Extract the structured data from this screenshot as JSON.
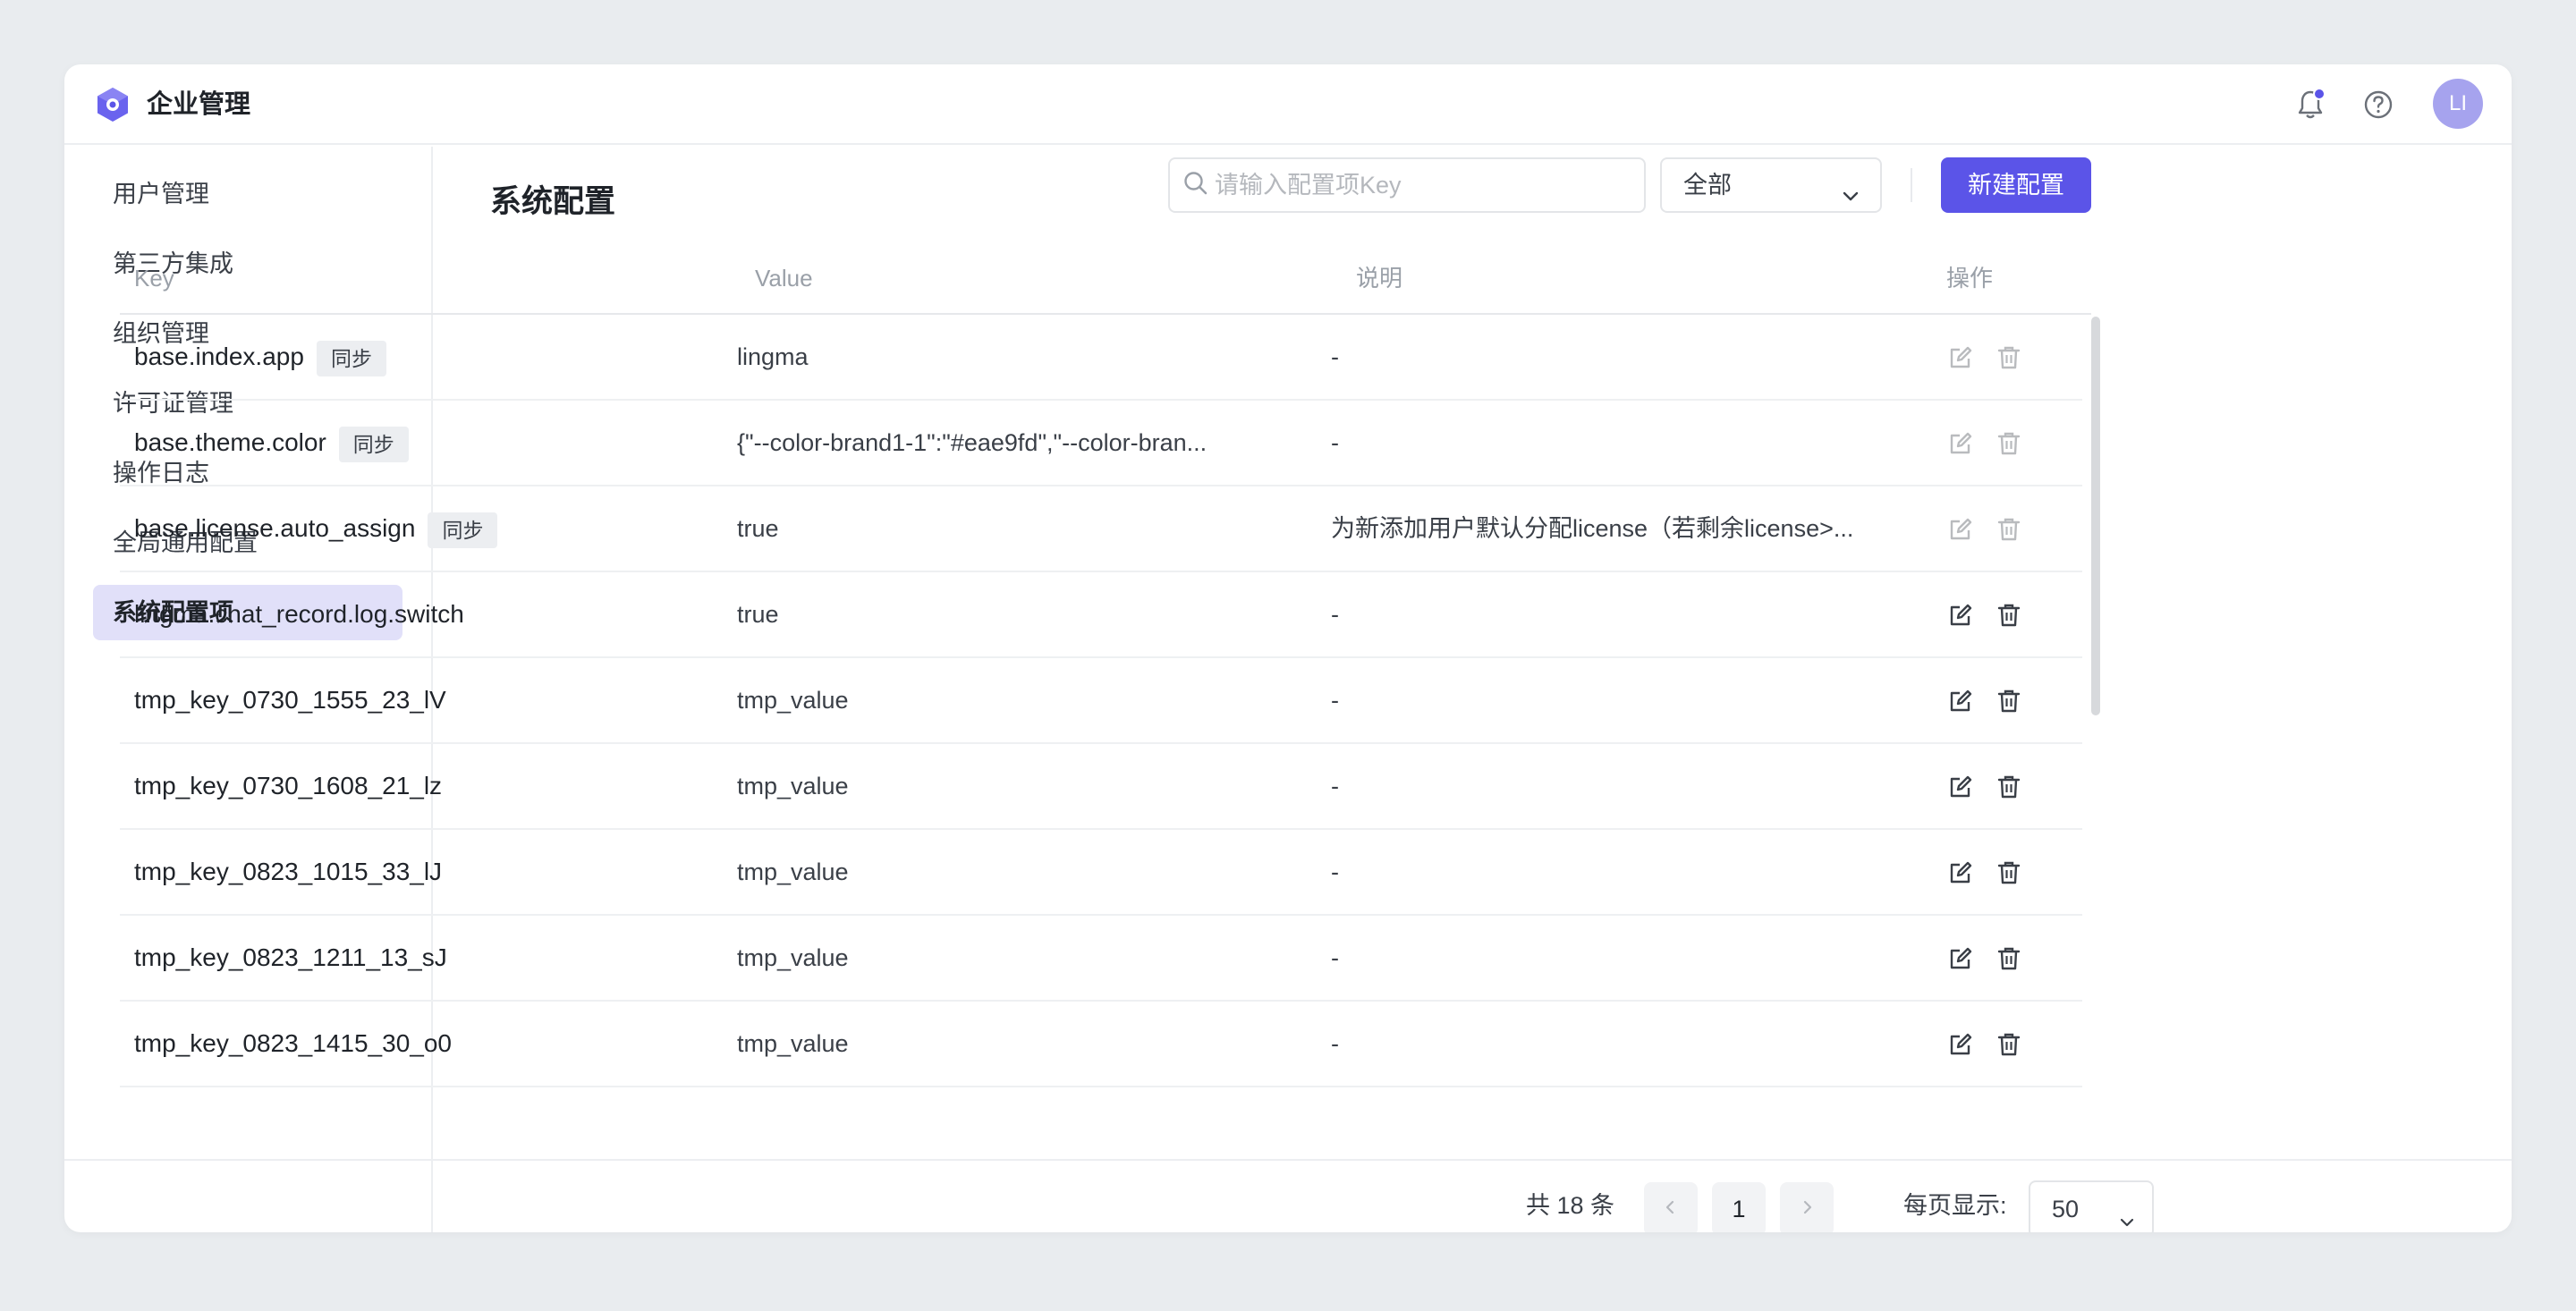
{
  "header": {
    "app_title": "企业管理",
    "avatar_text": "LI"
  },
  "sidebar": {
    "items": [
      {
        "label": "用户管理"
      },
      {
        "label": "第三方集成"
      },
      {
        "label": "组织管理"
      },
      {
        "label": "许可证管理"
      },
      {
        "label": "操作日志"
      },
      {
        "label": "全局通用配置"
      },
      {
        "label": "系统配置项",
        "active": true
      }
    ]
  },
  "main": {
    "title": "系统配置",
    "search_placeholder": "请输入配置项Key",
    "filter_value": "全部",
    "new_button": "新建配置"
  },
  "table": {
    "columns": [
      "Key",
      "Value",
      "说明",
      "操作"
    ],
    "rows": [
      {
        "key": "base.index.app",
        "tag": "同步",
        "value": "lingma",
        "desc": "-",
        "disabled": true
      },
      {
        "key": "base.theme.color",
        "tag": "同步",
        "value": "{\"--color-brand1-1\":\"#eae9fd\",\"--color-bran...",
        "desc": "-",
        "disabled": true
      },
      {
        "key": "base.license.auto_assign",
        "tag": "同步",
        "value": "true",
        "desc": "为新添加用户默认分配license（若剩余license>...",
        "disabled": true
      },
      {
        "key": "lingma.chat_record.log.switch",
        "tag": "",
        "value": "true",
        "desc": "-",
        "disabled": false
      },
      {
        "key": "tmp_key_0730_1555_23_lV",
        "tag": "",
        "value": "tmp_value",
        "desc": "-",
        "disabled": false
      },
      {
        "key": "tmp_key_0730_1608_21_lz",
        "tag": "",
        "value": "tmp_value",
        "desc": "-",
        "disabled": false
      },
      {
        "key": "tmp_key_0823_1015_33_lJ",
        "tag": "",
        "value": "tmp_value",
        "desc": "-",
        "disabled": false
      },
      {
        "key": "tmp_key_0823_1211_13_sJ",
        "tag": "",
        "value": "tmp_value",
        "desc": "-",
        "disabled": false
      },
      {
        "key": "tmp_key_0823_1415_30_o0",
        "tag": "",
        "value": "tmp_value",
        "desc": "-",
        "disabled": false
      }
    ]
  },
  "pagination": {
    "total_text": "共 18 条",
    "current_page": "1",
    "per_page_label": "每页显示:",
    "per_page_value": "50"
  },
  "colors": {
    "accent": "#5b54e8",
    "active_nav_bg": "#e1e0f9",
    "avatar_bg": "#a6a3ee"
  },
  "icons": {
    "logo": "hexagon-logo-icon",
    "notifications": "bell-icon",
    "help": "question-circle-icon",
    "search": "search-icon",
    "dropdown": "chevron-down-icon",
    "edit": "edit-icon",
    "delete": "trash-icon",
    "prev": "chevron-left-icon",
    "next": "chevron-right-icon"
  }
}
